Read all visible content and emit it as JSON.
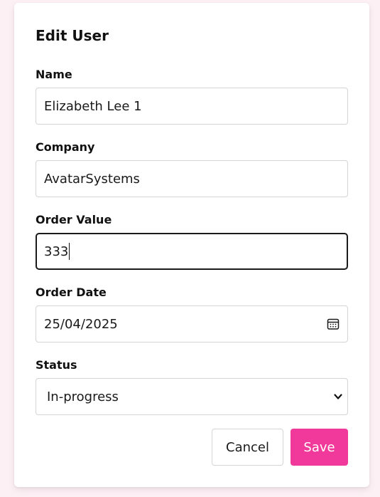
{
  "dialog": {
    "title": "Edit User"
  },
  "fields": {
    "name": {
      "label": "Name",
      "value": "Elizabeth Lee 1"
    },
    "company": {
      "label": "Company",
      "value": "AvatarSystems"
    },
    "order_value": {
      "label": "Order Value",
      "value": "333"
    },
    "order_date": {
      "label": "Order Date",
      "value": "25/04/2025"
    },
    "status": {
      "label": "Status",
      "value": "In-progress"
    }
  },
  "buttons": {
    "cancel_label": "Cancel",
    "save_label": "Save"
  },
  "colors": {
    "accent": "#f0399a",
    "background": "#fdf0f5"
  },
  "icons": {
    "date": "calendar-icon",
    "select": "chevron-down-icon"
  }
}
